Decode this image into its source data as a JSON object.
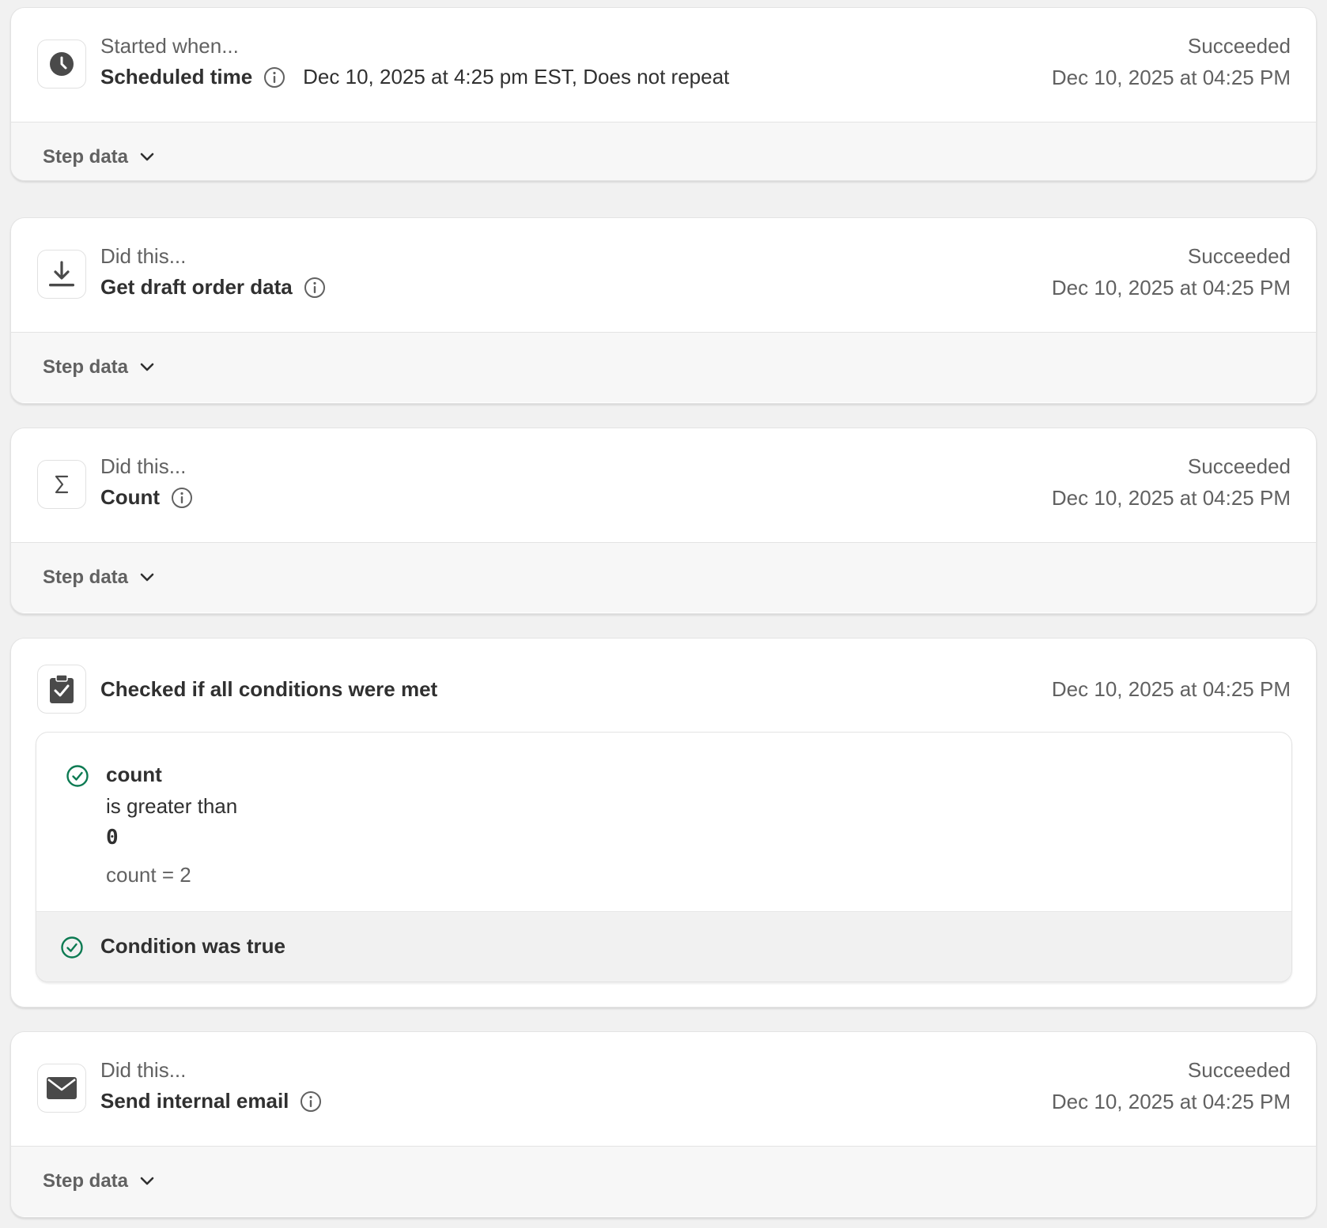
{
  "steps": [
    {
      "icon": "clock-icon",
      "sub_label": "Started when...",
      "title": "Scheduled time",
      "detail": "Dec 10, 2025 at 4:25 pm EST, Does not repeat",
      "status": "Succeeded",
      "timestamp": "Dec 10, 2025 at 04:25 PM",
      "step_data_label": "Step data"
    },
    {
      "icon": "download-icon",
      "sub_label": "Did this...",
      "title": "Get draft order data",
      "status": "Succeeded",
      "timestamp": "Dec 10, 2025 at 04:25 PM",
      "step_data_label": "Step data"
    },
    {
      "icon": "sigma-icon",
      "sub_label": "Did this...",
      "title": "Count",
      "status": "Succeeded",
      "timestamp": "Dec 10, 2025 at 04:25 PM",
      "step_data_label": "Step data"
    }
  ],
  "condition": {
    "icon": "clipboard-check-icon",
    "title": "Checked if all conditions were met",
    "timestamp": "Dec 10, 2025 at 04:25 PM",
    "variable": "count",
    "operator": "is greater than",
    "value": "0",
    "evaluation": "count = 2",
    "result": "Condition was true",
    "accent": "#0c7a52"
  },
  "email_step": {
    "icon": "mail-icon",
    "sub_label": "Did this...",
    "title": "Send internal email",
    "status": "Succeeded",
    "timestamp": "Dec 10, 2025 at 04:25 PM",
    "step_data_label": "Step data"
  }
}
